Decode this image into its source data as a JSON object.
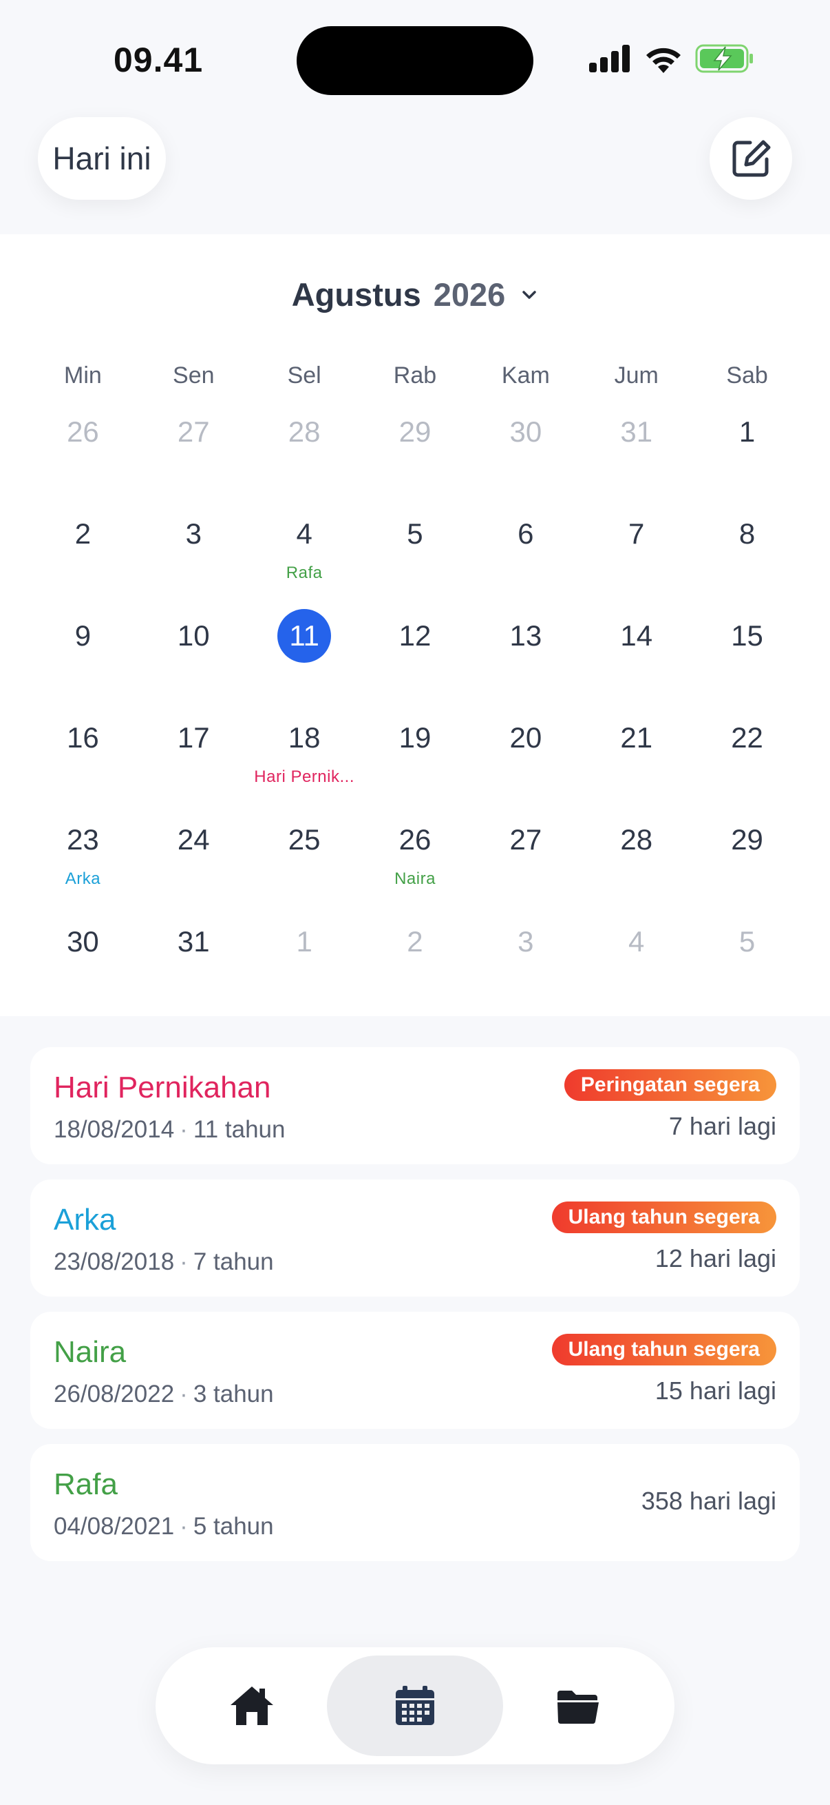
{
  "status_bar": {
    "time": "09.41"
  },
  "header": {
    "today_label": "Hari ini"
  },
  "calendar": {
    "month": "Agustus",
    "year": "2026",
    "weekdays": [
      "Min",
      "Sen",
      "Sel",
      "Rab",
      "Kam",
      "Jum",
      "Sab"
    ],
    "days": [
      {
        "n": "26",
        "muted": true
      },
      {
        "n": "27",
        "muted": true
      },
      {
        "n": "28",
        "muted": true
      },
      {
        "n": "29",
        "muted": true
      },
      {
        "n": "30",
        "muted": true
      },
      {
        "n": "31",
        "muted": true
      },
      {
        "n": "1"
      },
      {
        "n": "2"
      },
      {
        "n": "3"
      },
      {
        "n": "4",
        "event": "Rafa",
        "color": "#43a047"
      },
      {
        "n": "5"
      },
      {
        "n": "6"
      },
      {
        "n": "7"
      },
      {
        "n": "8"
      },
      {
        "n": "9"
      },
      {
        "n": "10"
      },
      {
        "n": "11",
        "selected": true
      },
      {
        "n": "12"
      },
      {
        "n": "13"
      },
      {
        "n": "14"
      },
      {
        "n": "15"
      },
      {
        "n": "16"
      },
      {
        "n": "17"
      },
      {
        "n": "18",
        "event": "Hari Pernik...",
        "color": "#e0245e"
      },
      {
        "n": "19"
      },
      {
        "n": "20"
      },
      {
        "n": "21"
      },
      {
        "n": "22"
      },
      {
        "n": "23",
        "event": "Arka",
        "color": "#1ba0d8"
      },
      {
        "n": "24"
      },
      {
        "n": "25"
      },
      {
        "n": "26",
        "event": "Naira",
        "color": "#43a047"
      },
      {
        "n": "27"
      },
      {
        "n": "28"
      },
      {
        "n": "29"
      },
      {
        "n": "30"
      },
      {
        "n": "31"
      },
      {
        "n": "1",
        "muted": true
      },
      {
        "n": "2",
        "muted": true
      },
      {
        "n": "3",
        "muted": true
      },
      {
        "n": "4",
        "muted": true
      },
      {
        "n": "5",
        "muted": true
      }
    ]
  },
  "events": [
    {
      "name": "Hari Pernikahan",
      "color": "#e0245e",
      "date": "18/08/2014",
      "age": "11 tahun",
      "badge": "Peringatan segera",
      "days_left": "7 hari lagi"
    },
    {
      "name": "Arka",
      "color": "#1ba0d8",
      "date": "23/08/2018",
      "age": "7 tahun",
      "badge": "Ulang tahun segera",
      "days_left": "12 hari lagi"
    },
    {
      "name": "Naira",
      "color": "#43a047",
      "date": "26/08/2022",
      "age": "3 tahun",
      "badge": "Ulang tahun segera",
      "days_left": "15 hari lagi"
    },
    {
      "name": "Rafa",
      "color": "#43a047",
      "date": "04/08/2021",
      "age": "5 tahun",
      "badge": "",
      "days_left": "358 hari lagi"
    }
  ],
  "bottom_nav": {
    "items": [
      {
        "icon": "home-icon",
        "active": false
      },
      {
        "icon": "calendar-icon",
        "active": true
      },
      {
        "icon": "folder-icon",
        "active": false
      }
    ]
  },
  "colors": {
    "accent": "#2563eb",
    "badge_start": "#ef3b2d",
    "badge_end": "#f7953a"
  }
}
